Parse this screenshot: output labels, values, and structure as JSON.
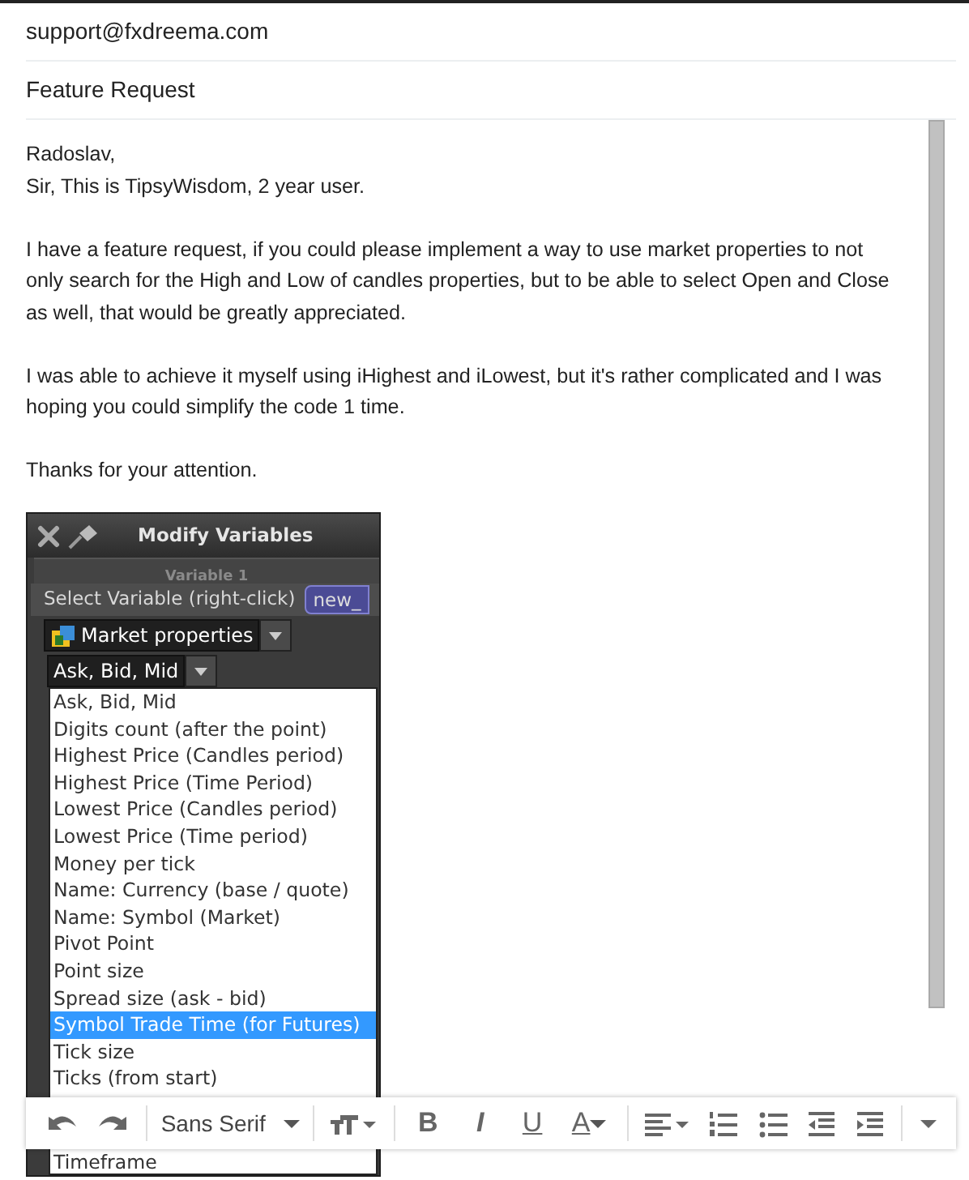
{
  "to": "support@fxdreema.com",
  "subject": "Feature Request",
  "body": [
    [
      "Radoslav,",
      "Sir, This is TipsyWisdom, 2 year user."
    ],
    [
      "I have a feature request, if you could please implement a way to use market properties to not",
      "only search for the High and Low of candles properties, but to be able to select Open and Close",
      "as well, that would be greatly appreciated."
    ],
    [
      "I was able to achieve it myself using iHighest and iLowest, but it's rather complicated and I was",
      "hoping you could simplify the code 1 time."
    ],
    [
      "Thanks for your attention."
    ]
  ],
  "attachment": {
    "title": "Modify Variables",
    "section": "Variable 1",
    "select_label": "Select Variable (right-click)",
    "variable_button": "new_",
    "category": "Market properties",
    "property": "Ask, Bid, Mid",
    "options": [
      {
        "label": "Ask, Bid, Mid",
        "selected": false
      },
      {
        "label": "Digits count (after the point)",
        "selected": false
      },
      {
        "label": "Highest Price (Candles period)",
        "selected": false
      },
      {
        "label": "Highest Price (Time Period)",
        "selected": false
      },
      {
        "label": "Lowest Price (Candles period)",
        "selected": false
      },
      {
        "label": "Lowest Price (Time period)",
        "selected": false
      },
      {
        "label": "Money per tick",
        "selected": false
      },
      {
        "label": "Name: Currency (base / quote)",
        "selected": false
      },
      {
        "label": "Name: Symbol (Market)",
        "selected": false
      },
      {
        "label": "Pivot Point",
        "selected": false
      },
      {
        "label": "Point size",
        "selected": false
      },
      {
        "label": "Spread size (ask - bid)",
        "selected": false
      },
      {
        "label": "Symbol Trade Time (for Futures)",
        "selected": true
      },
      {
        "label": "Tick size",
        "selected": false
      },
      {
        "label": "Ticks (from start)",
        "selected": false
      }
    ],
    "options_below_toolbar": [
      {
        "label": "Timeframe",
        "selected": false
      }
    ]
  },
  "toolbar": {
    "font": "Sans Serif",
    "bold": "B",
    "italic": "I",
    "underline": "U",
    "text_color": "A"
  }
}
